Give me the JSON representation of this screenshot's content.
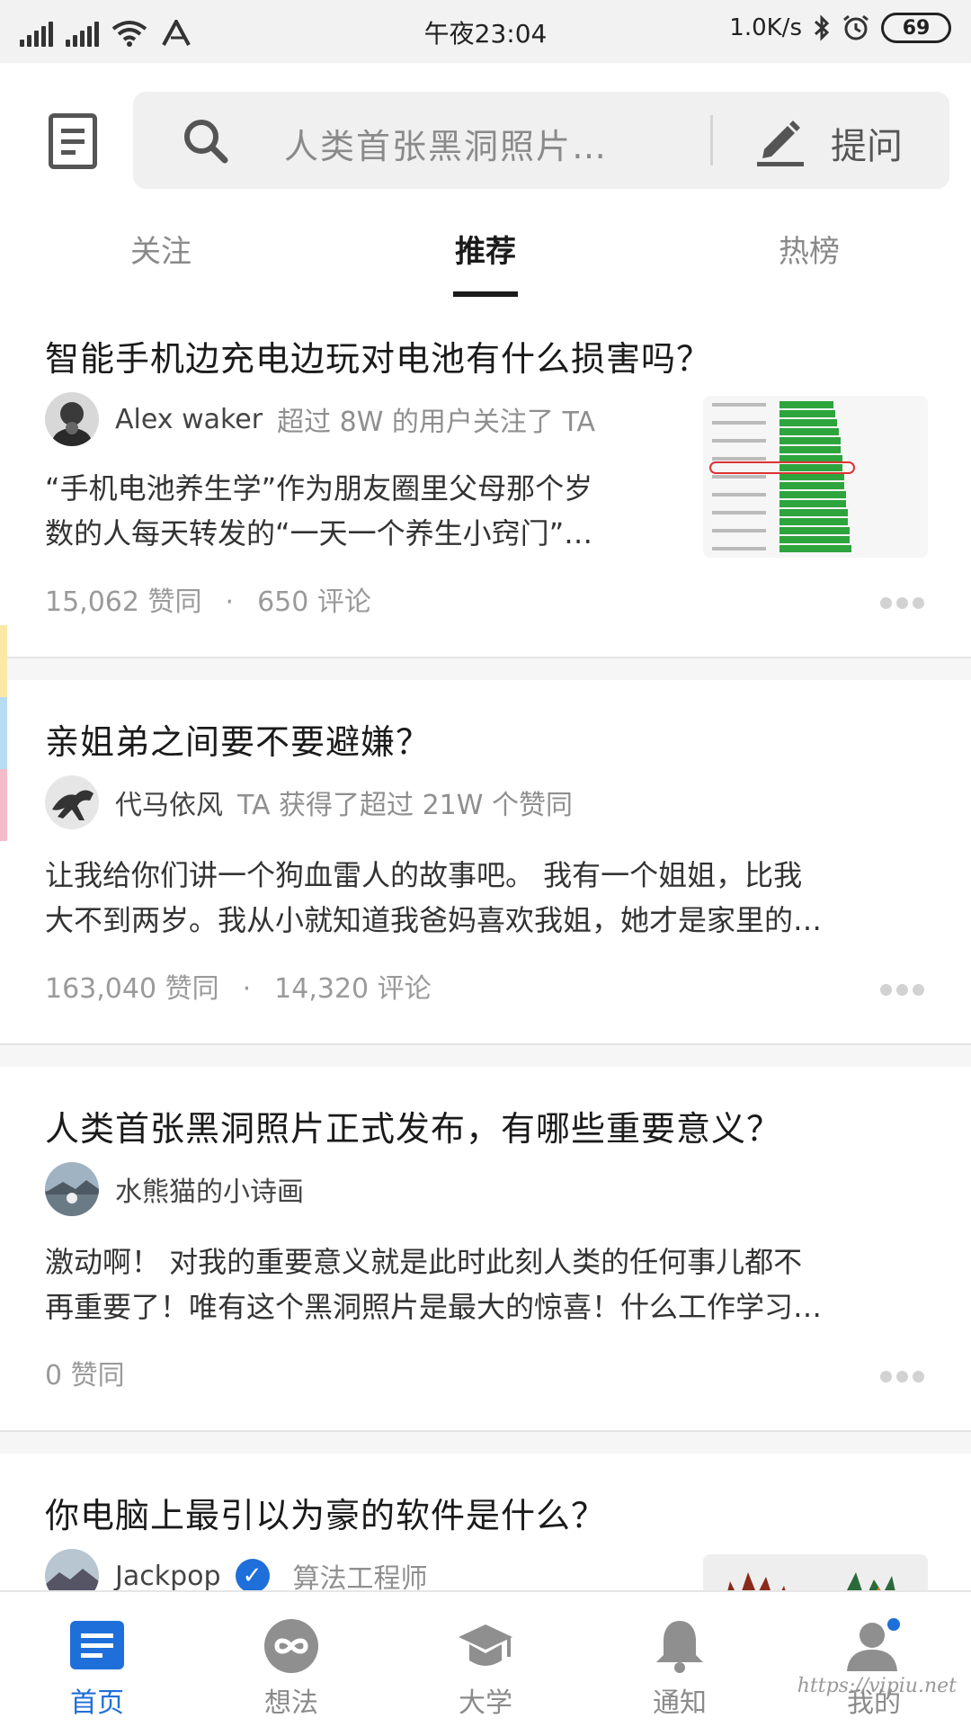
{
  "status_bar": {
    "time": "午夜23:04",
    "net_speed": "1.0K/s",
    "battery": "69"
  },
  "header": {
    "search_placeholder": "人类首张黑洞照片…",
    "ask_label": "提问",
    "tabs": [
      {
        "label": "关注",
        "active": false
      },
      {
        "label": "推荐",
        "active": true
      },
      {
        "label": "热榜",
        "active": false
      }
    ]
  },
  "feed": [
    {
      "title": "智能手机边充电边玩对电池有什么损害吗？",
      "author": "Alex waker",
      "author_meta": "超过 8W 的用户关注了 TA",
      "excerpt_lines": [
        "“手机电池养生学”作为朋友圈里父母那个岁",
        "数的人每天转发的“一天一个养生小窍门”…"
      ],
      "likes": "15,062 赞同",
      "comments": "650 评论",
      "has_thumbnail": true
    },
    {
      "title": "亲姐弟之间要不要避嫌？",
      "author": "代马依风",
      "author_meta": "TA 获得了超过 21W 个赞同",
      "excerpt_lines": [
        "让我给你们讲一个狗血雷人的故事吧。 我有一个姐姐，比我",
        "大不到两岁。我从小就知道我爸妈喜欢我姐，她才是家里的…"
      ],
      "likes": "163,040 赞同",
      "comments": "14,320 评论"
    },
    {
      "title": "人类首张黑洞照片正式发布，有哪些重要意义？",
      "author": "水熊猫的小诗画",
      "author_meta": "",
      "excerpt_lines": [
        "激动啊！ 对我的重要意义就是此时此刻人类的任何事儿都不",
        "再重要了！唯有这个黑洞照片是最大的惊喜！什么工作学习…"
      ],
      "likes": "0 赞同",
      "comments": ""
    },
    {
      "title": "你电脑上最引以为豪的软件是什么？",
      "author": "Jackpop",
      "author_meta": "算法工程师",
      "verified": true,
      "has_thumbnail": true
    }
  ],
  "bottom_nav": [
    {
      "label": "首页",
      "icon": "home-doc-icon",
      "active": true
    },
    {
      "label": "想法",
      "icon": "infinity-icon",
      "active": false
    },
    {
      "label": "大学",
      "icon": "graduation-cap-icon",
      "active": false
    },
    {
      "label": "通知",
      "icon": "bell-icon",
      "active": false
    },
    {
      "label": "我的",
      "icon": "person-icon",
      "active": false
    }
  ],
  "watermark": "https://vipiu.net",
  "colors": {
    "accent": "#1e6fd9",
    "text_primary": "#1a1a1a",
    "text_secondary": "#8a8a8a"
  }
}
